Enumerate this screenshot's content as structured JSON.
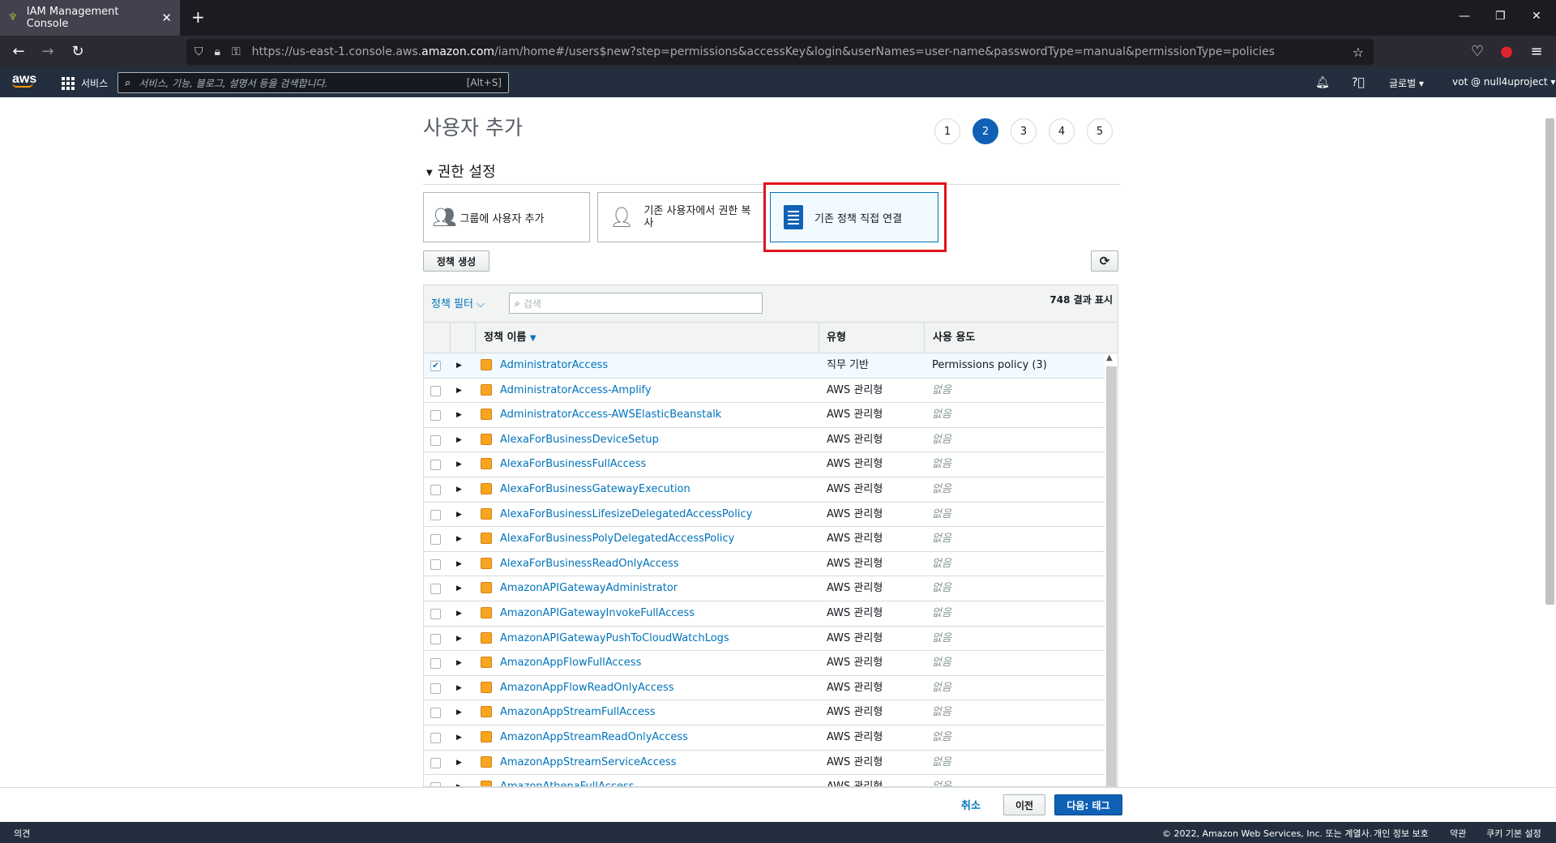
{
  "browser": {
    "tab_title": "IAM Management Console",
    "url_prefix": "https://us-east-1.console.aws.",
    "url_domain": "amazon.com",
    "url_suffix": "/iam/home#/users$new?step=permissions&accessKey&login&userNames=user-name&passwordType=manual&permissionType=policies"
  },
  "aws_header": {
    "logo_text": "aws",
    "services_label": "서비스",
    "search_placeholder": "서비스, 기능, 블로그, 설명서 등을 검색합니다.",
    "search_shortcut": "[Alt+S]",
    "region_label": "글로벌 ▾",
    "account_label": "vot @ null4uproject ▾"
  },
  "page": {
    "title": "사용자 추가",
    "steps": [
      "1",
      "2",
      "3",
      "4",
      "5"
    ],
    "active_step": "2",
    "section_title": "권한 설정",
    "options": [
      {
        "label": "그룹에 사용자 추가",
        "icon": "group-users-icon"
      },
      {
        "label": "기존 사용자에서 권한 복사",
        "icon": "user-icon"
      },
      {
        "label": "기존 정책 직접 연결",
        "icon": "document-icon",
        "selected": true
      }
    ],
    "create_policy_button": "정책 생성",
    "refresh_icon": "refresh-icon"
  },
  "table": {
    "filter_label": "정책 필터 ⌵",
    "search_placeholder": "검색",
    "result_count": "748 결과 표시",
    "headers": {
      "name": "정책 이름",
      "type": "유형",
      "usage": "사용 용도"
    },
    "rows": [
      {
        "name": "AdministratorAccess",
        "type": "직무 기반",
        "usage": "Permissions policy (3)",
        "checked": true
      },
      {
        "name": "AdministratorAccess-Amplify",
        "type": "AWS 관리형",
        "usage": "없음"
      },
      {
        "name": "AdministratorAccess-AWSElasticBeanstalk",
        "type": "AWS 관리형",
        "usage": "없음"
      },
      {
        "name": "AlexaForBusinessDeviceSetup",
        "type": "AWS 관리형",
        "usage": "없음"
      },
      {
        "name": "AlexaForBusinessFullAccess",
        "type": "AWS 관리형",
        "usage": "없음"
      },
      {
        "name": "AlexaForBusinessGatewayExecution",
        "type": "AWS 관리형",
        "usage": "없음"
      },
      {
        "name": "AlexaForBusinessLifesizeDelegatedAccessPolicy",
        "type": "AWS 관리형",
        "usage": "없음"
      },
      {
        "name": "AlexaForBusinessPolyDelegatedAccessPolicy",
        "type": "AWS 관리형",
        "usage": "없음"
      },
      {
        "name": "AlexaForBusinessReadOnlyAccess",
        "type": "AWS 관리형",
        "usage": "없음"
      },
      {
        "name": "AmazonAPIGatewayAdministrator",
        "type": "AWS 관리형",
        "usage": "없음"
      },
      {
        "name": "AmazonAPIGatewayInvokeFullAccess",
        "type": "AWS 관리형",
        "usage": "없음"
      },
      {
        "name": "AmazonAPIGatewayPushToCloudWatchLogs",
        "type": "AWS 관리형",
        "usage": "없음"
      },
      {
        "name": "AmazonAppFlowFullAccess",
        "type": "AWS 관리형",
        "usage": "없음"
      },
      {
        "name": "AmazonAppFlowReadOnlyAccess",
        "type": "AWS 관리형",
        "usage": "없음"
      },
      {
        "name": "AmazonAppStreamFullAccess",
        "type": "AWS 관리형",
        "usage": "없음"
      },
      {
        "name": "AmazonAppStreamReadOnlyAccess",
        "type": "AWS 관리형",
        "usage": "없음"
      },
      {
        "name": "AmazonAppStreamServiceAccess",
        "type": "AWS 관리형",
        "usage": "없음"
      },
      {
        "name": "AmazonAthenaFullAccess",
        "type": "AWS 관리형",
        "usage": "없음"
      }
    ]
  },
  "bottom_bar": {
    "cancel": "취소",
    "previous": "이전",
    "next": "다음: 태그"
  },
  "footer": {
    "feedback": "의견",
    "copyright": "© 2022, Amazon Web Services, Inc. 또는 계열사.",
    "privacy": "개인 정보 보호",
    "terms": "약관",
    "cookies": "쿠키 기본 설정"
  },
  "colors": {
    "aws_header": "#232f3e",
    "link_blue": "#0073bb",
    "primary_button": "#0f61b5",
    "highlight_red": "#e3131b",
    "policy_icon": "#f7a521"
  }
}
